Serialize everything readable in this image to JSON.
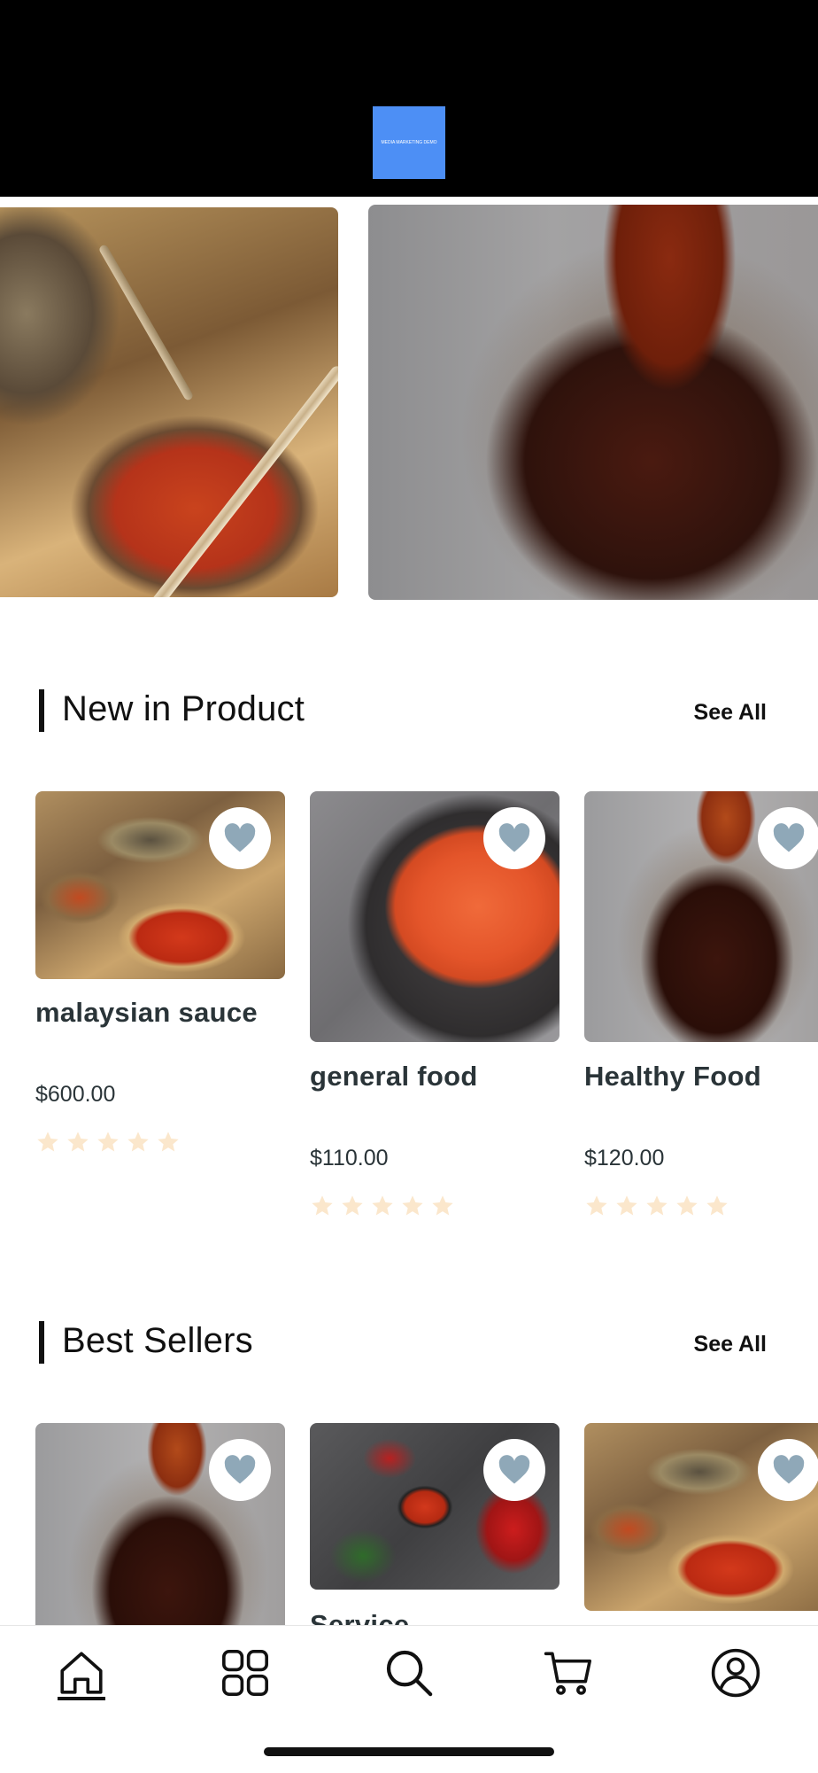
{
  "header": {
    "logo_text": "MEDIA MARKETING DEMO"
  },
  "sections": [
    {
      "title": "New in Product",
      "see_all": "See All",
      "products": [
        {
          "name": "malaysian sauce",
          "price": "$600.00",
          "rating": 0,
          "image": "sauce-pots"
        },
        {
          "name": "general food",
          "price": "$110.00",
          "rating": 0,
          "image": "fish-roe"
        },
        {
          "name": "Healthy Food",
          "price": "$120.00",
          "rating": 0,
          "image": "sauce-jar"
        }
      ]
    },
    {
      "title": "Best Sellers",
      "see_all": "See All",
      "products": [
        {
          "name": "",
          "image": "sauce-jar"
        },
        {
          "name": "Service",
          "image": "chili-bowl"
        },
        {
          "name": "",
          "image": "sauce-pots"
        }
      ]
    }
  ],
  "bottom_nav": [
    {
      "icon": "home-icon",
      "active": true
    },
    {
      "icon": "grid-icon",
      "active": false
    },
    {
      "icon": "search-icon",
      "active": false
    },
    {
      "icon": "cart-icon",
      "active": false
    },
    {
      "icon": "profile-icon",
      "active": false
    }
  ],
  "colors": {
    "header_bg": "#000000",
    "logo_bg": "#4d8ff5",
    "heart": "#8fa8b8",
    "star_empty": "#fbe7cc",
    "text": "#2a3438"
  }
}
